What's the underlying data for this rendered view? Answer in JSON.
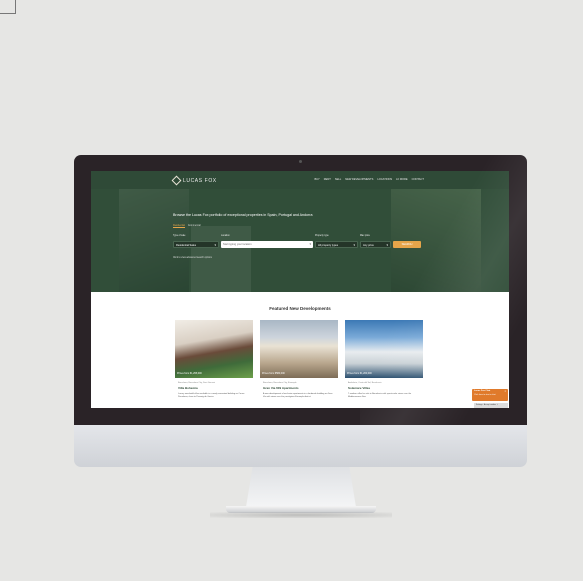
{
  "brand": {
    "name": "LUCAS FOX"
  },
  "nav": {
    "links": [
      "BUY",
      "RENT",
      "SELL",
      "NEW DEVELOPMENTS",
      "LOCATIONS",
      "LF MORE",
      "CONTACT"
    ]
  },
  "hero": {
    "tagline": "Browse the Lucas Fox portfolio of exceptional properties in Spain, Portugal and Andorra",
    "tabs": [
      "Residential",
      "Commercial"
    ],
    "fields": [
      {
        "label": "Type of sale",
        "value": "Residential Sales"
      },
      {
        "label": "Location",
        "value": "Start typing your location"
      },
      {
        "label": "Property type",
        "value": "All property types"
      },
      {
        "label": "Max price",
        "value": "Any price"
      }
    ],
    "search_button": "SEARCH",
    "advanced": "Click to view advanced search options"
  },
  "featured": {
    "title": "Featured New Developments",
    "cards": [
      {
        "price": "Prices from €1,295,000",
        "location": "Barcelona, Barcelona City, Sant Gervasi",
        "name": "Villa Bohemia",
        "desc": "Luxury new-build villas available in a newly renovated building on Carrer Pernalona, close to Passeig de Gracia."
      },
      {
        "price": "Prices from €580,000",
        "location": "Barcelona, Barcelona City, Eixample",
        "name": "Gran Via 609 Apartments",
        "desc": "A new development of exclusive apartments in a landmark building on Gran Via with views over the prestigious Eixample district."
      },
      {
        "price": "Prices from €1,200,000",
        "location": "Andalucia, Costa del Sol, Benahavis",
        "name": "Solemare Villas",
        "desc": "7 modern villas for sale in Benahavis with spectacular views over the Mediterranean Sea."
      }
    ]
  },
  "chat": {
    "title": "Lucas Fox Chat",
    "subtitle": "Click here to start a chat",
    "close": "×"
  },
  "cookie": {
    "text": "Settings · Accept cookies ✓"
  }
}
